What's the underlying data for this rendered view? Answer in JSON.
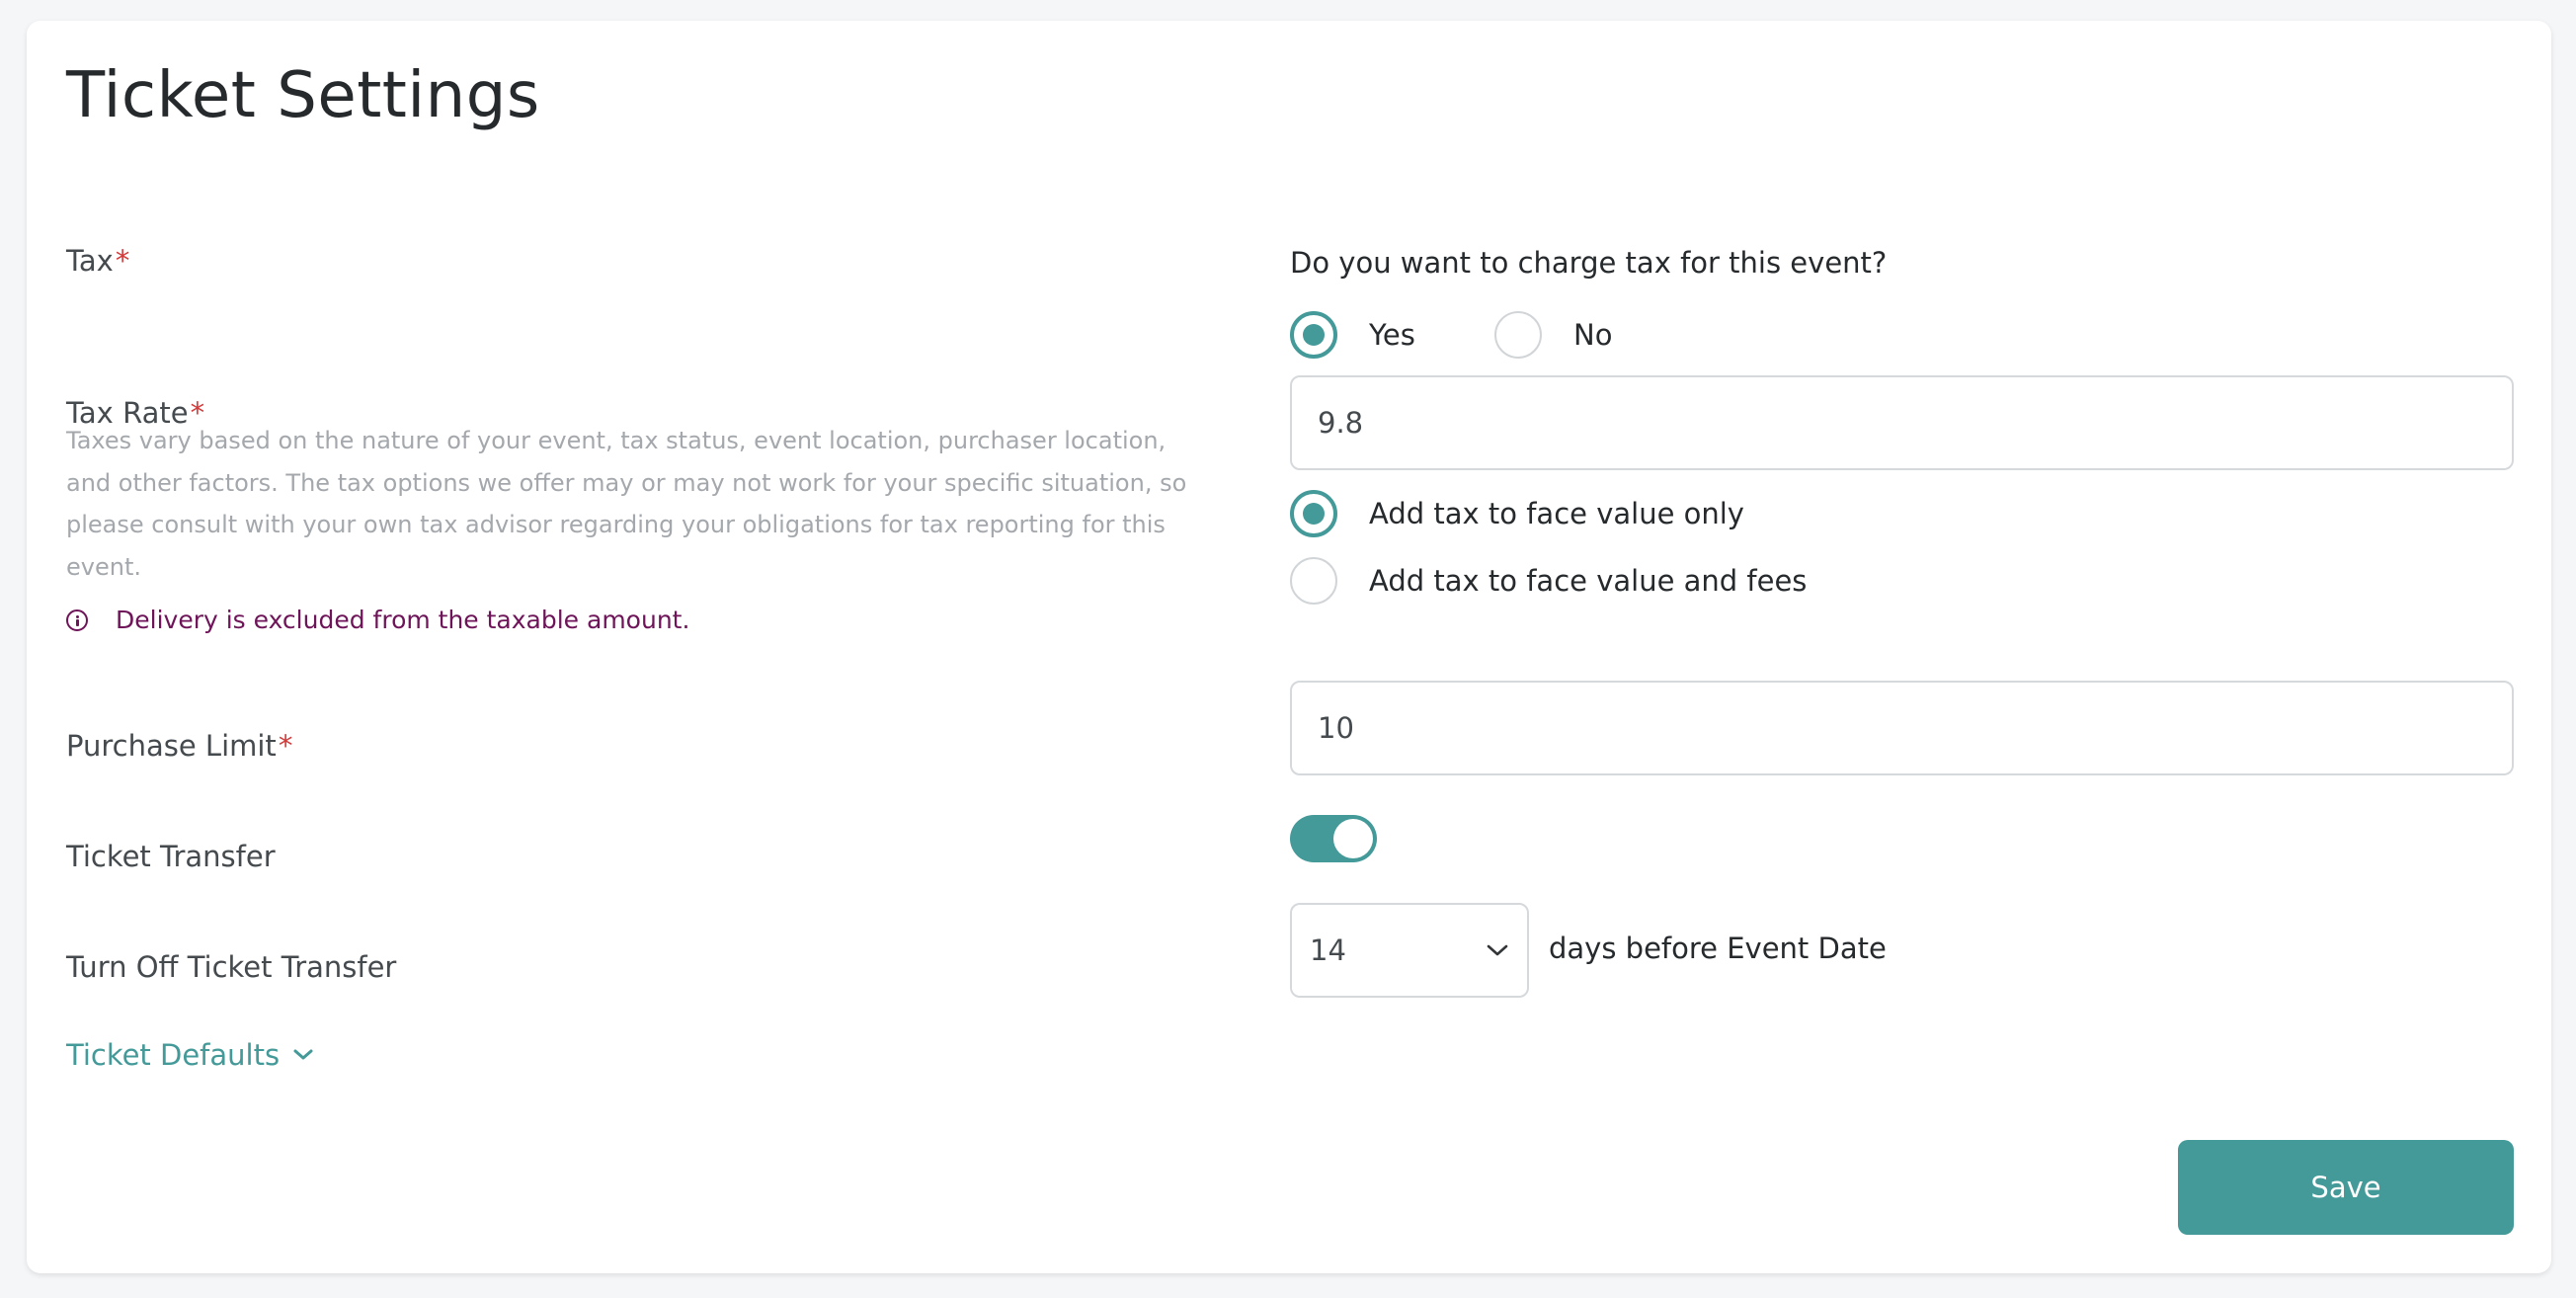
{
  "page": {
    "title": "Ticket Settings"
  },
  "tax": {
    "label": "Tax",
    "required_mark": "*",
    "question": "Do you want to charge tax for this event?",
    "options": [
      {
        "label": "Yes",
        "selected": true
      },
      {
        "label": "No",
        "selected": false
      }
    ]
  },
  "tax_rate": {
    "label": "Tax Rate",
    "required_mark": "*",
    "helper": "Taxes vary based on the nature of your event, tax status, event location, purchaser location, and other factors. The tax options we offer may or may not work for your specific situation, so please consult with your own tax advisor regarding your obligations for tax reporting for this event.",
    "info_icon": "info-circle-icon",
    "info_text": "Delivery is excluded from the taxable amount.",
    "value": "9.8",
    "apply_options": [
      {
        "label": "Add tax to face value only",
        "selected": true
      },
      {
        "label": "Add tax to face value and fees",
        "selected": false
      }
    ]
  },
  "purchase_limit": {
    "label": "Purchase Limit",
    "required_mark": "*",
    "value": "10"
  },
  "ticket_transfer": {
    "label": "Ticket Transfer",
    "enabled": true
  },
  "turn_off_transfer": {
    "label": "Turn Off Ticket Transfer",
    "selected_value": "14",
    "suffix": "days before Event Date"
  },
  "ticket_defaults": {
    "label": "Ticket Defaults",
    "icon": "chevron-down-icon"
  },
  "actions": {
    "save_label": "Save"
  },
  "colors": {
    "accent": "#449999",
    "required": "#d23a3a",
    "info": "#6e1458",
    "helper_text": "#a4a8ac"
  }
}
